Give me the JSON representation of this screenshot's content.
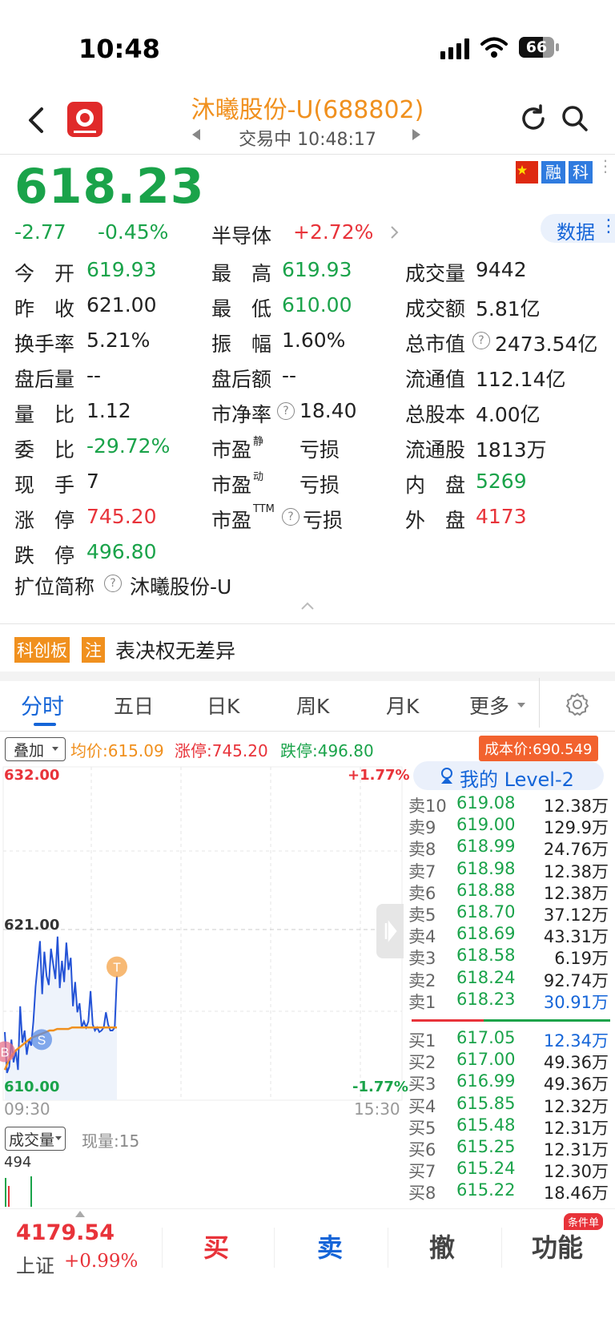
{
  "status": {
    "time": "10:48",
    "battery": "66"
  },
  "header": {
    "title": "沐曦股份-U(688802)",
    "status": "交易中 10:48:17"
  },
  "badges": [
    "融",
    "科"
  ],
  "quote": {
    "price": "618.23",
    "change": "-2.77",
    "change_pct": "-0.45%",
    "sector_name": "半导体",
    "sector_pct": "+2.72%",
    "data_button": "数据"
  },
  "stats": {
    "open_label": "今　开",
    "open": "619.93",
    "high_label": "最　高",
    "high": "619.93",
    "volume_label": "成交量",
    "volume": "9442",
    "prev_label": "昨　收",
    "prev": "621.00",
    "low_label": "最　低",
    "low": "610.00",
    "amount_label": "成交额",
    "amount": "5.81亿",
    "turnover_label": "换手率",
    "turnover": "5.21%",
    "amplitude_label": "振　幅",
    "amplitude": "1.60%",
    "mktcap_label": "总市值",
    "mktcap": "2473.54亿",
    "ah_vol_label": "盘后量",
    "ah_vol": "--",
    "ah_amt_label": "盘后额",
    "ah_amt": "--",
    "float_cap_label": "流通值",
    "float_cap": "112.14亿",
    "vol_ratio_label": "量　比",
    "vol_ratio": "1.12",
    "pb_label": "市净率",
    "pb": "18.40",
    "total_shares_label": "总股本",
    "total_shares": "4.00亿",
    "commit_label": "委　比",
    "commit": "-29.72%",
    "pe_static_label": "市盈",
    "pe_static_sup": "静",
    "pe_static": "亏损",
    "float_shares_label": "流通股",
    "float_shares": "1813万",
    "cur_hand_label": "现　手",
    "cur_hand": "7",
    "pe_dyn_label": "市盈",
    "pe_dyn_sup": "动",
    "pe_dyn": "亏损",
    "inner_label": "内　盘",
    "inner": "5269",
    "limit_up_label": "涨　停",
    "limit_up": "745.20",
    "pe_ttm_label": "市盈",
    "pe_ttm_sup": "TTM",
    "pe_ttm": "亏损",
    "outer_label": "外　盘",
    "outer": "4173",
    "limit_down_label": "跌　停",
    "limit_down": "496.80",
    "short_name_label": "扩位简称",
    "short_name": "沐曦股份-U"
  },
  "notice": {
    "tag1": "科创板",
    "tag2": "注",
    "text": "表决权无差异"
  },
  "tabs": [
    "分时",
    "五日",
    "日K",
    "周K",
    "月K",
    "更多"
  ],
  "chart_info": {
    "overlay_btn": "叠加",
    "avg": "均价:615.09",
    "limit_up": "涨停:745.20",
    "limit_down": "跌停:496.80",
    "cost": "成本价:690.549",
    "y_top": "632.00",
    "y_mid": "621.00",
    "y_bot": "610.00",
    "pct_top": "+1.77%",
    "pct_bot": "-1.77%",
    "t_start": "09:30",
    "t_end": "15:30",
    "vol_btn": "成交量",
    "cur_vol": "现量:15",
    "vol_max": "494",
    "marker_s": "S",
    "marker_t": "T",
    "marker_b": "B"
  },
  "chart_data": {
    "type": "line",
    "ylim": [
      610.0,
      632.0
    ],
    "x_range": [
      "09:30",
      "15:30"
    ],
    "series": [
      {
        "values": [
          614.5,
          611.8,
          612.2,
          614.0,
          612.5,
          613.3,
          612.0,
          616.2,
          613.8,
          614.6,
          613.0,
          614.0,
          613.6,
          615.2,
          617.5,
          619.0,
          620.5,
          617.0,
          619.8,
          618.2,
          617.6,
          620.0,
          619.0,
          618.0,
          620.8,
          617.4,
          619.2,
          617.8,
          620.4,
          618.6,
          619.4,
          616.2,
          617.8,
          615.8,
          616.4,
          614.8,
          615.2,
          614.8,
          615.2,
          617.2,
          615.0,
          614.6,
          614.8,
          614.5,
          614.6,
          614.8,
          615.8,
          615.0,
          614.6,
          614.6,
          614.8,
          618.2
        ]
      },
      {
        "values": [
          612.0,
          612.6,
          613.0,
          613.3,
          613.5,
          613.7,
          613.9,
          614.1,
          614.2,
          614.3,
          614.4,
          614.5,
          614.6,
          614.6,
          614.7,
          614.7,
          614.7,
          614.7,
          614.8,
          614.8,
          614.8,
          614.8,
          614.8,
          614.8,
          614.8,
          614.8,
          614.8,
          614.8,
          614.8,
          614.8,
          614.8
        ]
      }
    ]
  },
  "order_book": {
    "level2_label": "我的 Level-2",
    "asks": [
      {
        "label": "卖10",
        "price": "619.08",
        "vol": "12.38万"
      },
      {
        "label": "卖9",
        "price": "619.00",
        "vol": "129.9万"
      },
      {
        "label": "卖8",
        "price": "618.99",
        "vol": "24.76万"
      },
      {
        "label": "卖7",
        "price": "618.98",
        "vol": "12.38万"
      },
      {
        "label": "卖6",
        "price": "618.88",
        "vol": "12.38万"
      },
      {
        "label": "卖5",
        "price": "618.70",
        "vol": "37.12万"
      },
      {
        "label": "卖4",
        "price": "618.69",
        "vol": "43.31万"
      },
      {
        "label": "卖3",
        "price": "618.58",
        "vol": "6.19万"
      },
      {
        "label": "卖2",
        "price": "618.24",
        "vol": "92.74万"
      },
      {
        "label": "卖1",
        "price": "618.23",
        "vol": "30.91万"
      }
    ],
    "bids": [
      {
        "label": "买1",
        "price": "617.05",
        "vol": "12.34万"
      },
      {
        "label": "买2",
        "price": "617.00",
        "vol": "49.36万"
      },
      {
        "label": "买3",
        "price": "616.99",
        "vol": "49.36万"
      },
      {
        "label": "买4",
        "price": "615.85",
        "vol": "12.32万"
      },
      {
        "label": "买5",
        "price": "615.48",
        "vol": "12.31万"
      },
      {
        "label": "买6",
        "price": "615.25",
        "vol": "12.31万"
      },
      {
        "label": "买7",
        "price": "615.24",
        "vol": "12.30万"
      },
      {
        "label": "买8",
        "price": "615.22",
        "vol": "18.46万"
      }
    ]
  },
  "bottom": {
    "index_value": "4179.54",
    "index_name": "上证",
    "index_pct": "+0.99%",
    "buy": "买",
    "sell": "卖",
    "cancel": "撤",
    "func": "功能",
    "cond_badge": "条件单"
  },
  "colors": {
    "up": "#e8333a",
    "down": "#1aa34a",
    "accent": "#f0901e",
    "blue": "#1565d8"
  }
}
